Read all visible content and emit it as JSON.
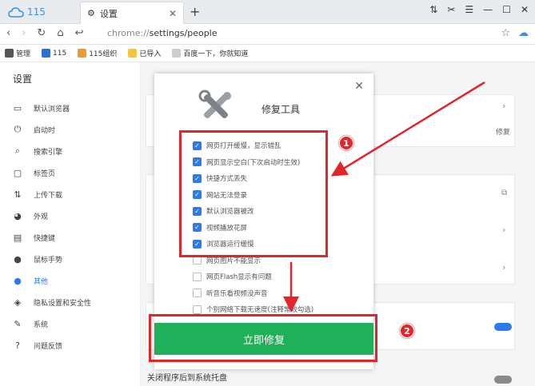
{
  "browser": {
    "brand": "115",
    "tab_title": "设置",
    "url_prefix": "chrome://",
    "url_path": "settings/people"
  },
  "bookmarks": [
    {
      "label": "管理",
      "color": "#555555"
    },
    {
      "label": "115",
      "color": "#2d6fd6"
    },
    {
      "label": "115组织",
      "color": "#f29a2e"
    },
    {
      "label": "已导入",
      "color": "#f2c53d"
    },
    {
      "label": "百度一下，你就知道",
      "color": "#cccccc"
    }
  ],
  "sidebar": {
    "heading": "设置",
    "items": [
      {
        "label": "默认浏览器",
        "icon": "browser-icon"
      },
      {
        "label": "启动时",
        "icon": "power-icon"
      },
      {
        "label": "搜索引擎",
        "icon": "search-icon"
      },
      {
        "label": "标签页",
        "icon": "tab-icon"
      },
      {
        "label": "上传下载",
        "icon": "transfer-icon"
      },
      {
        "label": "外观",
        "icon": "palette-icon"
      },
      {
        "label": "快捷键",
        "icon": "keyboard-icon"
      },
      {
        "label": "鼠标手势",
        "icon": "mouse-icon"
      },
      {
        "label": "其他",
        "icon": "person-icon",
        "active": true
      },
      {
        "label": "隐私设置和安全性",
        "icon": "shield-icon"
      },
      {
        "label": "系统",
        "icon": "wrench-icon"
      },
      {
        "label": "问题反馈",
        "icon": "help-icon"
      }
    ]
  },
  "main": {
    "repair_link": "修复",
    "bottom_row_label": "关闭程序后到系统托盘"
  },
  "modal": {
    "title": "修复工具",
    "options": [
      {
        "label": "网页打开缓慢，显示错乱",
        "checked": true
      },
      {
        "label": "网页显示空白(下次启动时生效)",
        "checked": true
      },
      {
        "label": "快捷方式丢失",
        "checked": true
      },
      {
        "label": "网站无法登录",
        "checked": true
      },
      {
        "label": "默认浏览器被改",
        "checked": true
      },
      {
        "label": "视频播放花屏",
        "checked": true
      },
      {
        "label": "浏览器运行缓慢",
        "checked": true
      },
      {
        "label": "网页图片不能显示",
        "checked": false
      },
      {
        "label": "网页Flash显示有问题",
        "checked": false
      },
      {
        "label": "听音乐看视频没声音",
        "checked": false
      },
      {
        "label": "个别网络下载无速度(注释常效勾选)",
        "checked": false
      }
    ],
    "fix_button": "立即修复"
  },
  "annotations": {
    "badge_1": "1",
    "badge_2": "2",
    "color": "#e0262b"
  },
  "colors": {
    "accent": "#2d7be5",
    "fix_button": "#1fb05a"
  }
}
